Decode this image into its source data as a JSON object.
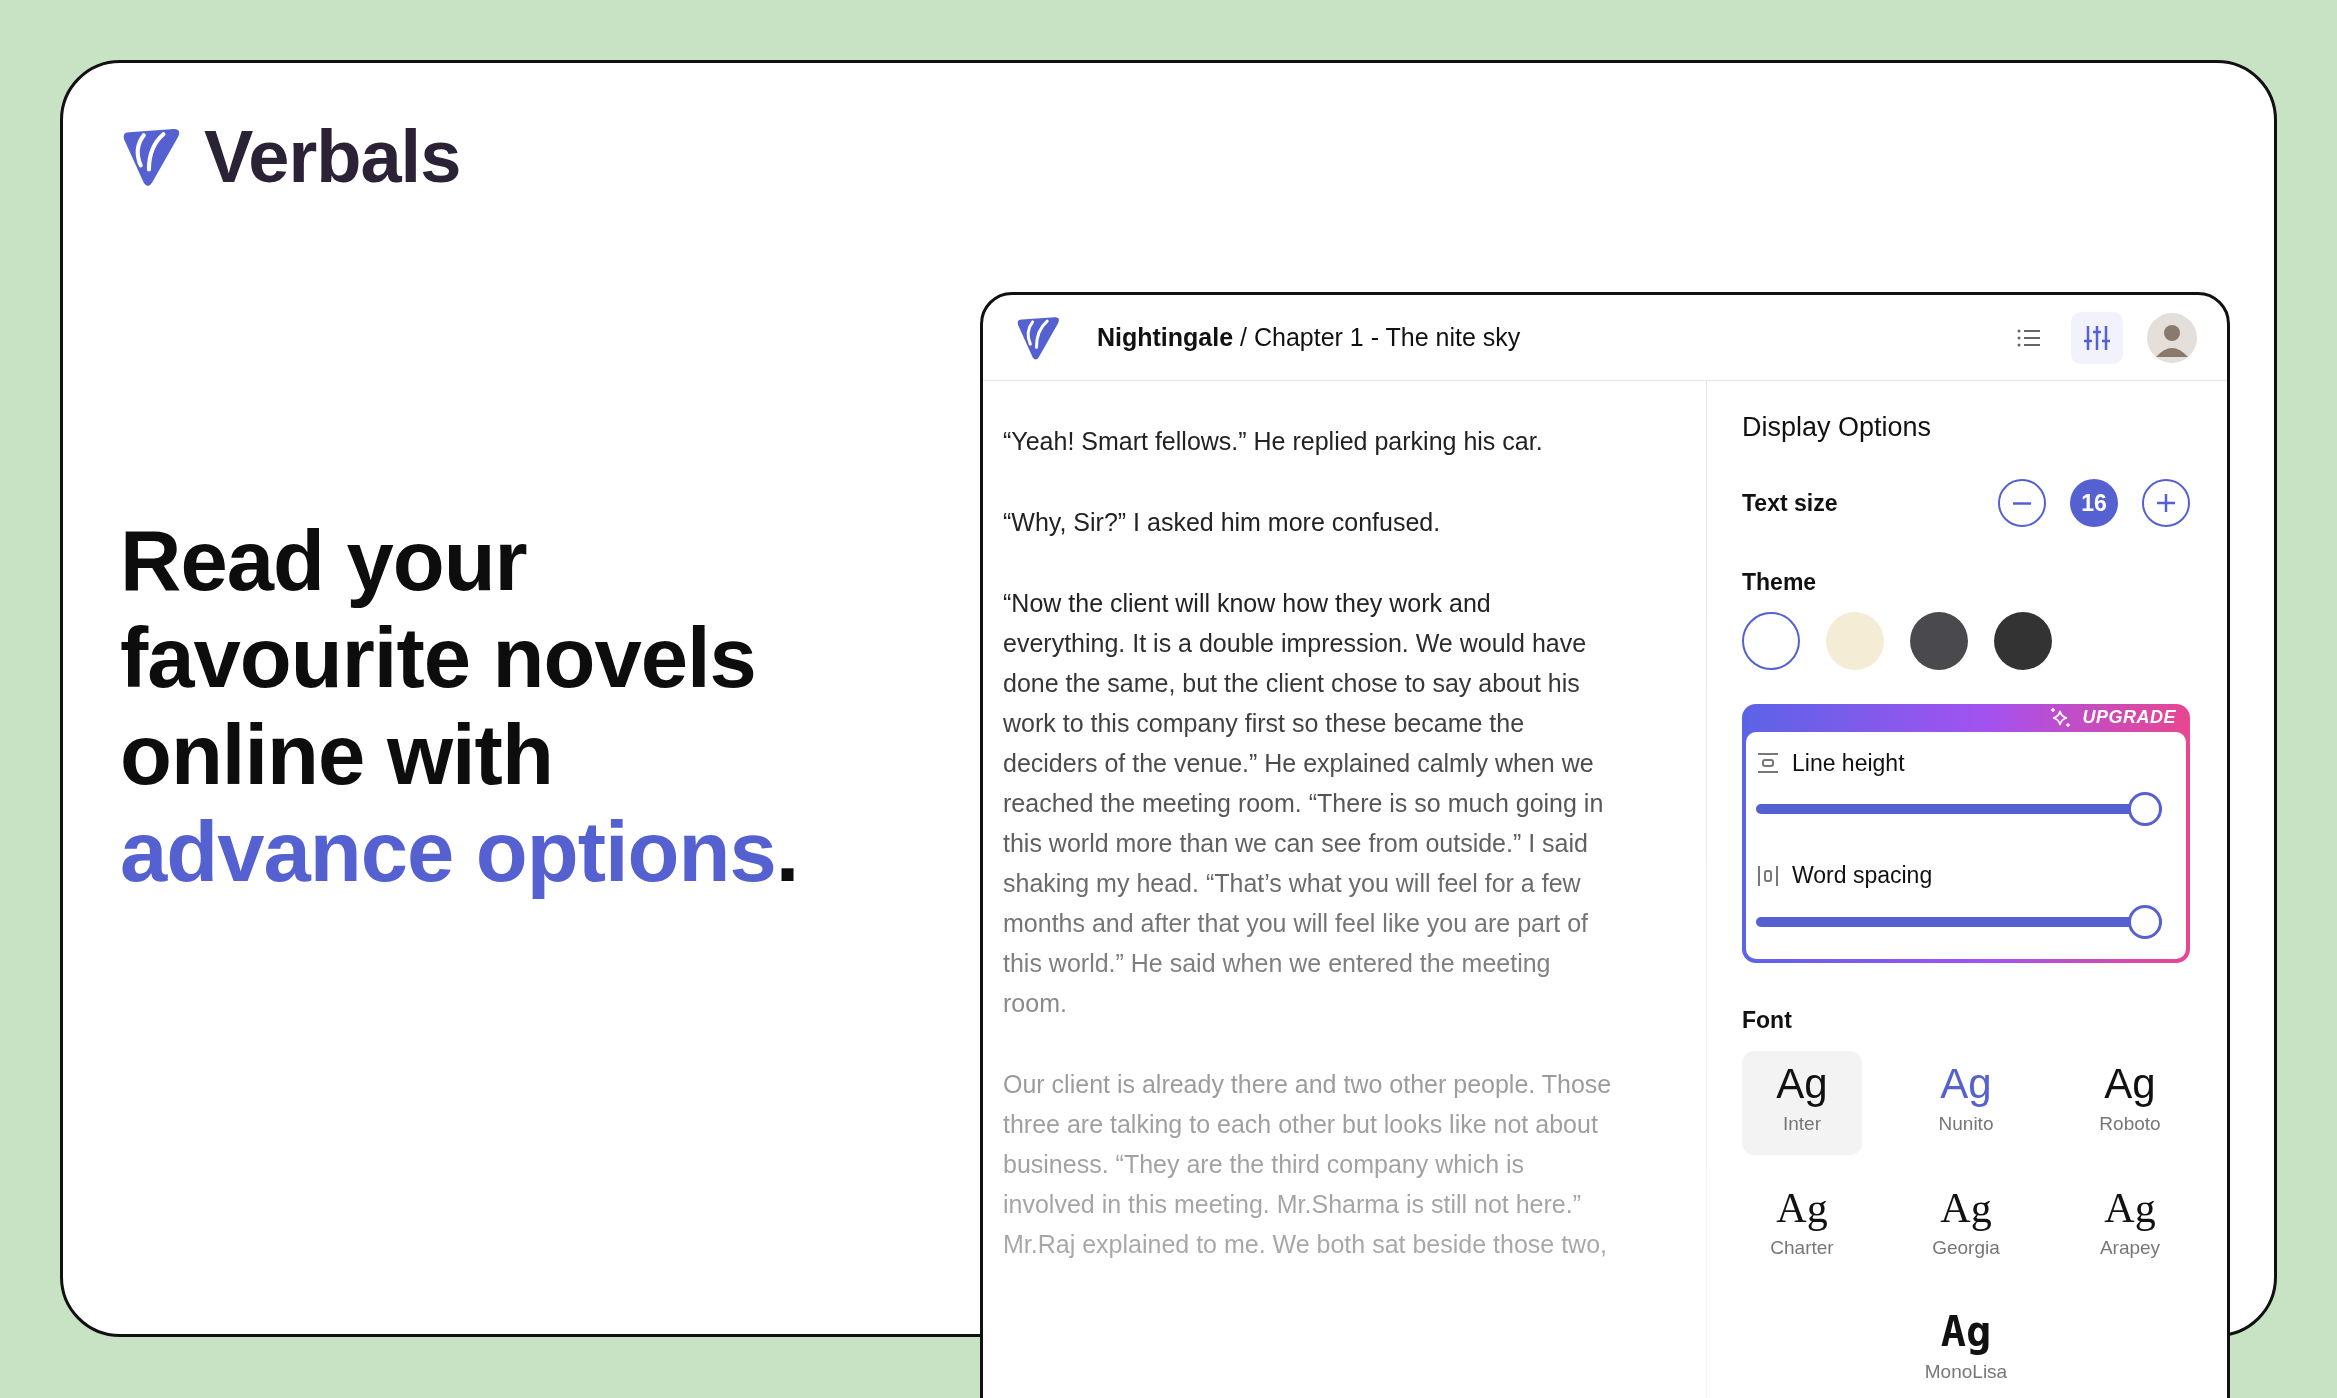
{
  "brand": {
    "name": "Verbals"
  },
  "headline": {
    "lines": [
      "Read your",
      "favourite novels",
      "online with"
    ],
    "highlight": "advance options",
    "end": "."
  },
  "reader": {
    "title": "**Nightingale** / Chapter 1 - The nite sky",
    "toolbar": [
      {
        "kind": "list",
        "selected": false
      },
      {
        "kind": "settings",
        "selected": true
      }
    ],
    "paragraphs": [
      {
        "lines": [
          "“Yeah! Smart fellows.” He replied parking his car."
        ]
      },
      {
        "lines": [
          "“Why, Sir?” I asked him more confused."
        ]
      },
      {
        "lines": [
          "“Now the client will know how they work and",
          "everything. It is a double impression. We would have",
          "done the same, but the client chose to say about his",
          "work to this company first so these became the",
          "deciders of the venue.” He explained calmly when we",
          "reached the meeting room. “There is so much going in",
          "this world more than we can see from outside.” I said",
          "shaking my head. “That’s what you will feel for a few",
          "months and after that you will feel like you are part of",
          "this world.” He said when we entered the meeting",
          "room."
        ]
      },
      {
        "lines": [
          "Our client is already there and two other people. Those",
          "three are talking to each other but looks like not about",
          "business. “They are the third company which is",
          "involved in this meeting. Mr.Sharma is still not here.”",
          "Mr.Raj explained to me. We both sat beside those two,"
        ]
      }
    ],
    "display_options": {
      "title": "Display Options",
      "text_size": {
        "label": "Text size",
        "value": "16"
      },
      "theme": {
        "label": "Theme",
        "swatches": [
          {
            "color": "#ffffff",
            "selected": true
          },
          {
            "color": "#f5ecd5",
            "selected": false
          },
          {
            "color": "#4a4a4e",
            "selected": false
          },
          {
            "color": "#333333",
            "selected": false
          }
        ]
      },
      "upgrade": {
        "badge": "UPGRADE",
        "sliders": [
          {
            "kind": "line-height",
            "label": "Line height",
            "level": 1
          },
          {
            "kind": "word-spacing",
            "label": "Word spacing",
            "level": 1
          }
        ]
      },
      "font": {
        "label": "Font",
        "options": [
          {
            "sample": "Ag",
            "name": "Inter",
            "kind": "sans",
            "selected": true,
            "highlighted": false
          },
          {
            "sample": "Ag",
            "name": "Nunito",
            "kind": "sans",
            "selected": false,
            "highlighted": true
          },
          {
            "sample": "Ag",
            "name": "Roboto",
            "kind": "sans",
            "selected": false,
            "highlighted": false
          },
          {
            "sample": "Ag",
            "name": "Charter",
            "kind": "serif",
            "selected": false,
            "highlighted": false
          },
          {
            "sample": "Ag",
            "name": "Georgia",
            "kind": "serif",
            "selected": false,
            "highlighted": false
          },
          {
            "sample": "Ag",
            "name": "Arapey",
            "kind": "serif",
            "selected": false,
            "highlighted": false
          },
          {
            "sample": "Ag",
            "name": "MonoLisa",
            "kind": "mono",
            "selected": false,
            "highlighted": false
          }
        ]
      }
    }
  }
}
